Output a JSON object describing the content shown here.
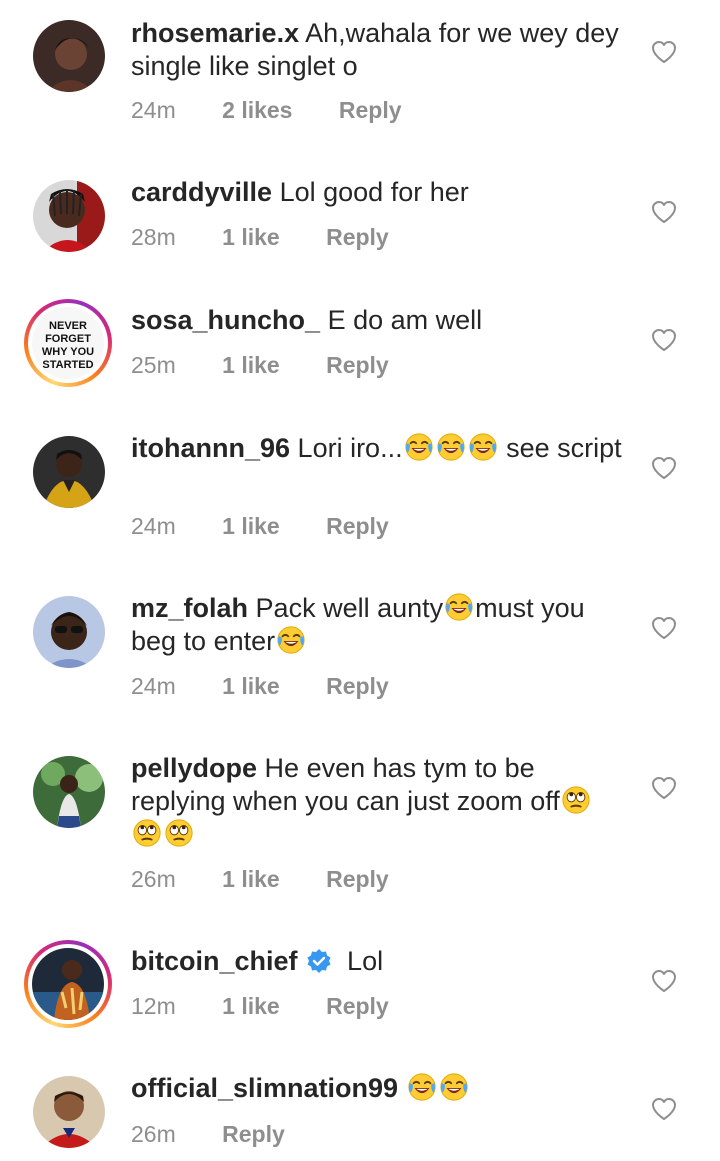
{
  "comments": [
    {
      "username": "rhosemarie.x",
      "text": "Ah,wahala for we wey dey single like singlet o",
      "time": "24m",
      "likes": "2 likes",
      "reply": "Reply"
    },
    {
      "username": "carddyville",
      "text": "Lol good for her",
      "time": "28m",
      "likes": "1 like",
      "reply": "Reply"
    },
    {
      "username": "sosa_huncho_",
      "text": "E do am well",
      "time": "25m",
      "likes": "1 like",
      "reply": "Reply",
      "avatar_text": [
        "NEVER",
        "FORGET",
        "WHY YOU",
        "STARTED"
      ]
    },
    {
      "username": "itohannn_96",
      "text_before": "Lori iro...",
      "text_after": " see script",
      "time": "24m",
      "likes": "1 like",
      "reply": "Reply"
    },
    {
      "username": "mz_folah",
      "text_a": "Pack well aunty",
      "text_b": "must you beg to enter",
      "time": "24m",
      "likes": "1 like",
      "reply": "Reply"
    },
    {
      "username": "pellydope",
      "text": "He even has tym to be replying when you can just zoom off",
      "time": "26m",
      "likes": "1 like",
      "reply": "Reply"
    },
    {
      "username": "bitcoin_chief",
      "text": "Lol",
      "time": "12m",
      "likes": "1 like",
      "reply": "Reply"
    },
    {
      "username": "official_slimnation99",
      "time": "26m",
      "reply": "Reply"
    }
  ],
  "colors": {
    "text": "#262626",
    "meta": "#8e8e8e",
    "verified": "#3897f0"
  },
  "icons": [
    "heart-outline-icon",
    "tears-of-joy-emoji",
    "eye-roll-emoji",
    "verified-badge-icon"
  ]
}
